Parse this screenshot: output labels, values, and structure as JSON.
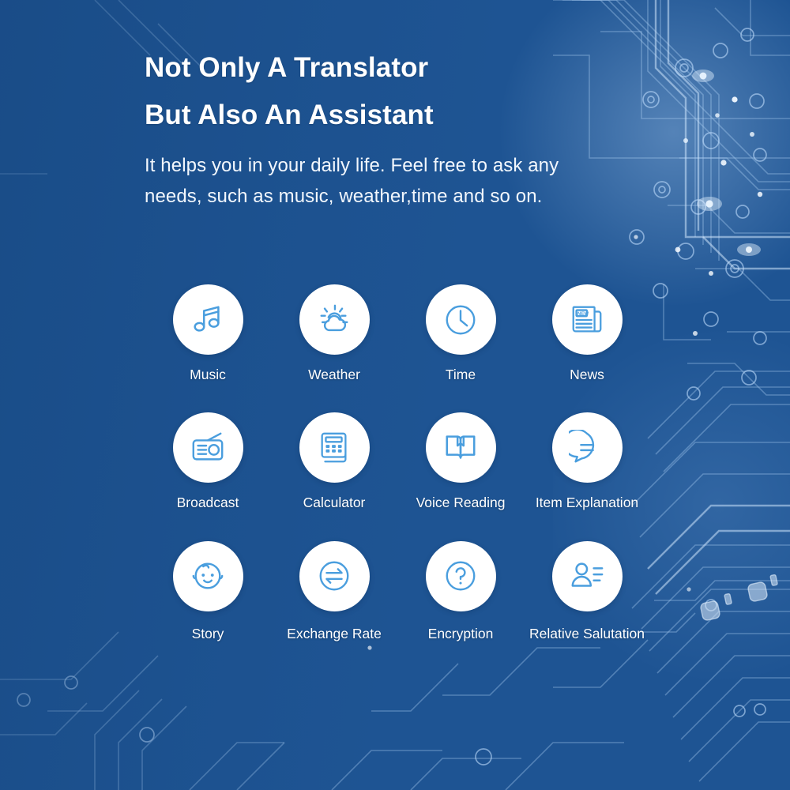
{
  "theme": {
    "background_color": "#1e5493",
    "icon_color": "#4a9ede",
    "bubble_color": "#ffffff",
    "text_color": "#ffffff"
  },
  "hero": {
    "heading_line1": "Not Only A Translator",
    "heading_line2": "But Also An Assistant",
    "body_line1": "It helps you in your daily life. Feel free to ask any",
    "body_line2": "needs, such as music, weather,time and so on."
  },
  "features": {
    "rows": [
      [
        {
          "label": "Music",
          "icon": "music-note-icon"
        },
        {
          "label": "Weather",
          "icon": "sun-cloud-icon"
        },
        {
          "label": "Time",
          "icon": "clock-icon"
        },
        {
          "label": "News",
          "icon": "newspaper-icon",
          "icon_text": "NEW"
        }
      ],
      [
        {
          "label": "Broadcast",
          "icon": "radio-icon"
        },
        {
          "label": "Calculator",
          "icon": "calculator-icon"
        },
        {
          "label": "Voice Reading",
          "icon": "open-book-icon"
        },
        {
          "label": "Item Explanation",
          "icon": "speech-bubble-icon"
        }
      ],
      [
        {
          "label": "Story",
          "icon": "baby-face-icon"
        },
        {
          "label": "Exchange Rate",
          "icon": "exchange-arrows-icon"
        },
        {
          "label": "Encryption",
          "icon": "question-mark-circle-icon"
        },
        {
          "label": "Relative Salutation",
          "icon": "person-lines-icon"
        }
      ]
    ]
  }
}
